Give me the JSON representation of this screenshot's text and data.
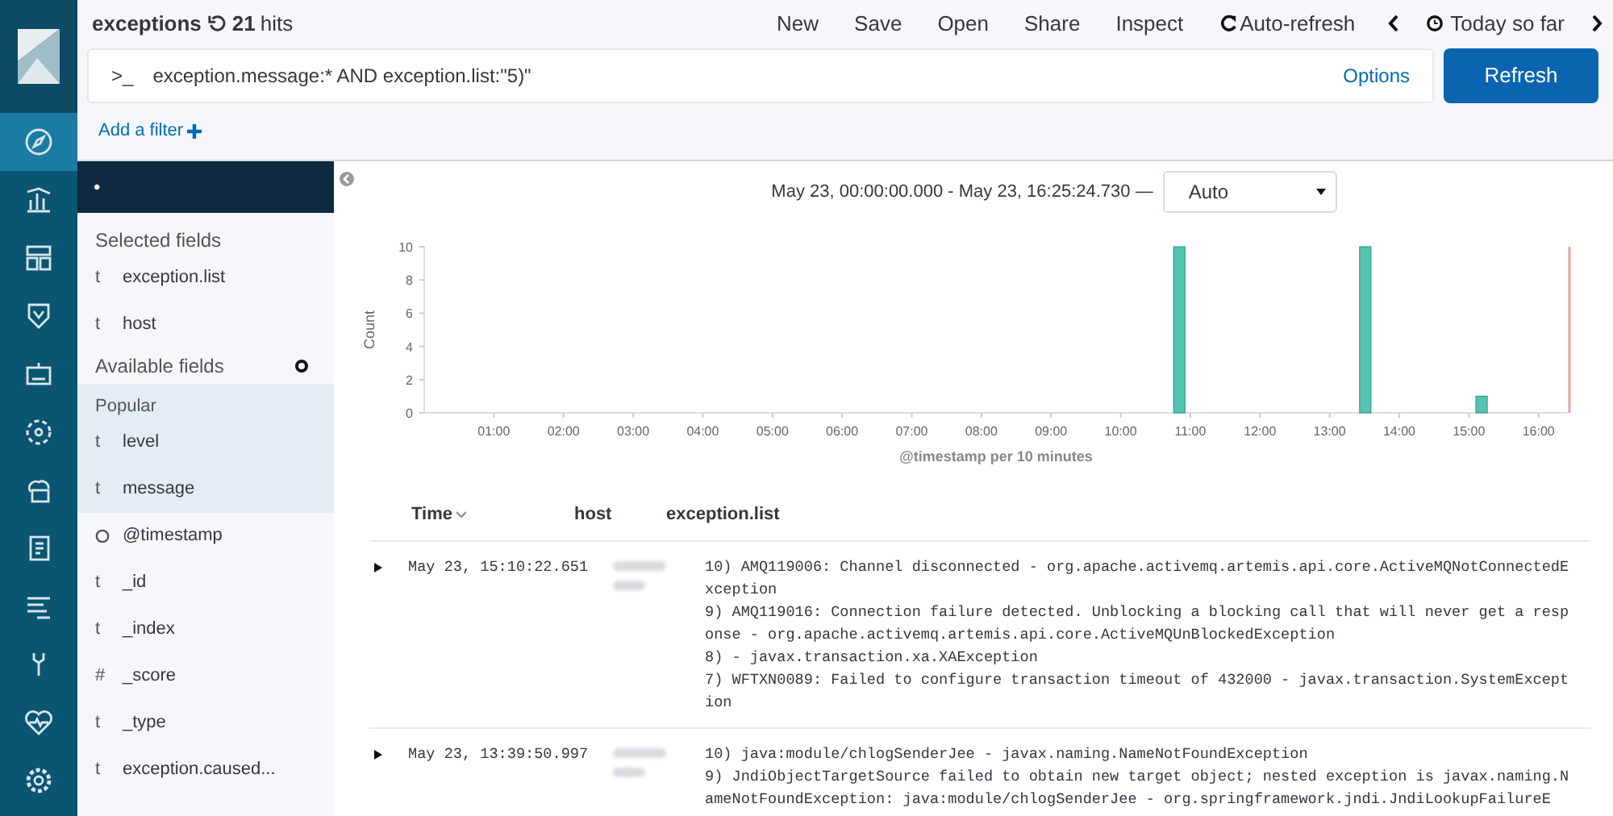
{
  "nav": {
    "items": [
      {
        "kind": "discover",
        "selected": true
      },
      {
        "kind": "visualize",
        "selected": false
      },
      {
        "kind": "dashboard",
        "selected": false
      },
      {
        "kind": "timelion",
        "selected": false
      },
      {
        "kind": "canvas",
        "selected": false
      },
      {
        "kind": "ml",
        "selected": false
      },
      {
        "kind": "infra",
        "selected": false
      },
      {
        "kind": "logs",
        "selected": false
      },
      {
        "kind": "apm",
        "selected": false
      },
      {
        "kind": "devtools",
        "selected": false
      },
      {
        "kind": "monitoring",
        "selected": false
      },
      {
        "kind": "management",
        "selected": false
      }
    ]
  },
  "header": {
    "title": "exceptions",
    "hits_count": "21",
    "hits_label": "hits",
    "menu": [
      "New",
      "Save",
      "Open",
      "Share",
      "Inspect"
    ],
    "auto_refresh": "Auto-refresh",
    "time_range": "Today so far"
  },
  "query": {
    "prompt": ">_",
    "value": "exception.message:* AND exception.list:\"5)\"",
    "options": "Options",
    "refresh": "Refresh"
  },
  "filter": {
    "add_label": "Add a filter"
  },
  "sidebar": {
    "index_pattern": "•",
    "selected_title": "Selected fields",
    "selected_fields": [
      {
        "type_label": "t",
        "name": "exception.list"
      },
      {
        "type_label": "t",
        "name": "host"
      }
    ],
    "available_title": "Available fields",
    "popular_title": "Popular",
    "popular_fields": [
      {
        "type_label": "t",
        "name": "level"
      },
      {
        "type_label": "t",
        "name": "message"
      }
    ],
    "other_fields": [
      {
        "kind": "clock",
        "name": "@timestamp"
      },
      {
        "kind": "text",
        "type_label": "t",
        "name": "_id"
      },
      {
        "kind": "text",
        "type_label": "t",
        "name": "_index"
      },
      {
        "kind": "text",
        "type_label": "#",
        "name": "_score"
      },
      {
        "kind": "text",
        "type_label": "t",
        "name": "_type"
      },
      {
        "kind": "text",
        "type_label": "t",
        "name": "exception.caused..."
      }
    ]
  },
  "chart": {
    "range": "May 23, 00:00:00.000 - May 23, 16:25:24.730 —",
    "interval": "Auto",
    "chart_data": {
      "type": "bar",
      "xlabel": "@timestamp per 10 minutes",
      "ylabel": "Count",
      "x": [
        10.83,
        13.5,
        15.17
      ],
      "values": [
        10,
        10,
        1
      ],
      "xlim": [
        0,
        16.42
      ],
      "ylim": [
        0,
        10
      ],
      "xticks": [
        {
          "value": 1,
          "label": "01:00"
        },
        {
          "value": 2,
          "label": "02:00"
        },
        {
          "value": 3,
          "label": "03:00"
        },
        {
          "value": 4,
          "label": "04:00"
        },
        {
          "value": 5,
          "label": "05:00"
        },
        {
          "value": 6,
          "label": "06:00"
        },
        {
          "value": 7,
          "label": "07:00"
        },
        {
          "value": 8,
          "label": "08:00"
        },
        {
          "value": 9,
          "label": "09:00"
        },
        {
          "value": 10,
          "label": "10:00"
        },
        {
          "value": 11,
          "label": "11:00"
        },
        {
          "value": 12,
          "label": "12:00"
        },
        {
          "value": 13,
          "label": "13:00"
        },
        {
          "value": 14,
          "label": "14:00"
        },
        {
          "value": 15,
          "label": "15:00"
        },
        {
          "value": 16,
          "label": "16:00"
        }
      ],
      "yticks": [
        0,
        2,
        4,
        6,
        8,
        10
      ]
    }
  },
  "table": {
    "columns": [
      "Time",
      "host",
      "exception.list"
    ],
    "rows": [
      {
        "time": "May 23, 15:10:22.651",
        "lines": [
          "10) AMQ119006: Channel disconnected - org.apache.activemq.artemis.api.core.ActiveMQNotConnectedException",
          "9) AMQ119016: Connection failure detected. Unblocking a blocking call that will never get a response - org.apache.activemq.artemis.api.core.ActiveMQUnBlockedException",
          "8)  - javax.transaction.xa.XAException",
          "7) WFTXN0089: Failed to configure transaction timeout of 432000 - javax.transaction.SystemException"
        ]
      },
      {
        "time": "May 23, 13:39:50.997",
        "lines": [
          "10) java:module/chlogSenderJee - javax.naming.NameNotFoundException",
          "9) JndiObjectTargetSource failed to obtain new target object; nested exception is javax.naming.NameNotFoundException: java:module/chlogSenderJee - org.springframework.jndi.JndiLookupFailureE"
        ]
      }
    ]
  }
}
